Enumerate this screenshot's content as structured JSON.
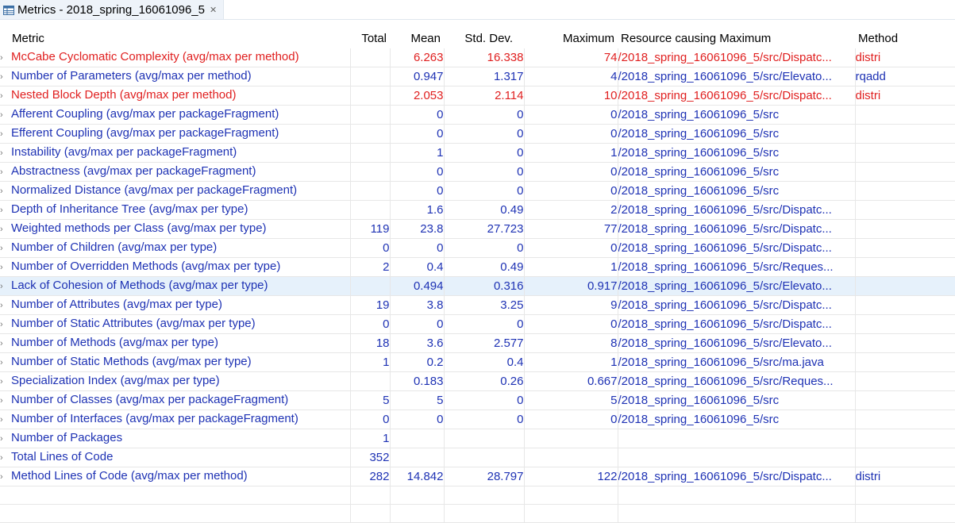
{
  "tab": {
    "title": "Metrics - 2018_spring_16061096_5",
    "close": "✕"
  },
  "columns": [
    "Metric",
    "Total",
    "Mean",
    "Std. Dev.",
    "Maximum",
    "Resource causing Maximum",
    "Method"
  ],
  "colors": {
    "normal": "#1e32b4",
    "warning": "#e02020",
    "selected_bg": "#e6f1fb"
  },
  "rows": [
    {
      "metric": "McCabe Cyclomatic Complexity (avg/max per method)",
      "total": "",
      "mean": "6.263",
      "std": "16.338",
      "max": "74",
      "resource": "/2018_spring_16061096_5/src/Dispatc...",
      "method": "distri",
      "status": "red"
    },
    {
      "metric": "Number of Parameters (avg/max per method)",
      "total": "",
      "mean": "0.947",
      "std": "1.317",
      "max": "4",
      "resource": "/2018_spring_16061096_5/src/Elevato...",
      "method": "rqadd",
      "status": "blue"
    },
    {
      "metric": "Nested Block Depth (avg/max per method)",
      "total": "",
      "mean": "2.053",
      "std": "2.114",
      "max": "10",
      "resource": "/2018_spring_16061096_5/src/Dispatc...",
      "method": "distri",
      "status": "red"
    },
    {
      "metric": "Afferent Coupling (avg/max per packageFragment)",
      "total": "",
      "mean": "0",
      "std": "0",
      "max": "0",
      "resource": "/2018_spring_16061096_5/src",
      "method": "",
      "status": "blue"
    },
    {
      "metric": "Efferent Coupling (avg/max per packageFragment)",
      "total": "",
      "mean": "0",
      "std": "0",
      "max": "0",
      "resource": "/2018_spring_16061096_5/src",
      "method": "",
      "status": "blue"
    },
    {
      "metric": "Instability (avg/max per packageFragment)",
      "total": "",
      "mean": "1",
      "std": "0",
      "max": "1",
      "resource": "/2018_spring_16061096_5/src",
      "method": "",
      "status": "blue"
    },
    {
      "metric": "Abstractness (avg/max per packageFragment)",
      "total": "",
      "mean": "0",
      "std": "0",
      "max": "0",
      "resource": "/2018_spring_16061096_5/src",
      "method": "",
      "status": "blue"
    },
    {
      "metric": "Normalized Distance (avg/max per packageFragment)",
      "total": "",
      "mean": "0",
      "std": "0",
      "max": "0",
      "resource": "/2018_spring_16061096_5/src",
      "method": "",
      "status": "blue"
    },
    {
      "metric": "Depth of Inheritance Tree (avg/max per type)",
      "total": "",
      "mean": "1.6",
      "std": "0.49",
      "max": "2",
      "resource": "/2018_spring_16061096_5/src/Dispatc...",
      "method": "",
      "status": "blue"
    },
    {
      "metric": "Weighted methods per Class (avg/max per type)",
      "total": "119",
      "mean": "23.8",
      "std": "27.723",
      "max": "77",
      "resource": "/2018_spring_16061096_5/src/Dispatc...",
      "method": "",
      "status": "blue"
    },
    {
      "metric": "Number of Children (avg/max per type)",
      "total": "0",
      "mean": "0",
      "std": "0",
      "max": "0",
      "resource": "/2018_spring_16061096_5/src/Dispatc...",
      "method": "",
      "status": "blue"
    },
    {
      "metric": "Number of Overridden Methods (avg/max per type)",
      "total": "2",
      "mean": "0.4",
      "std": "0.49",
      "max": "1",
      "resource": "/2018_spring_16061096_5/src/Reques...",
      "method": "",
      "status": "blue"
    },
    {
      "metric": "Lack of Cohesion of Methods (avg/max per type)",
      "total": "",
      "mean": "0.494",
      "std": "0.316",
      "max": "0.917",
      "resource": "/2018_spring_16061096_5/src/Elevato...",
      "method": "",
      "status": "blue",
      "selected": true
    },
    {
      "metric": "Number of Attributes (avg/max per type)",
      "total": "19",
      "mean": "3.8",
      "std": "3.25",
      "max": "9",
      "resource": "/2018_spring_16061096_5/src/Dispatc...",
      "method": "",
      "status": "blue"
    },
    {
      "metric": "Number of Static Attributes (avg/max per type)",
      "total": "0",
      "mean": "0",
      "std": "0",
      "max": "0",
      "resource": "/2018_spring_16061096_5/src/Dispatc...",
      "method": "",
      "status": "blue"
    },
    {
      "metric": "Number of Methods (avg/max per type)",
      "total": "18",
      "mean": "3.6",
      "std": "2.577",
      "max": "8",
      "resource": "/2018_spring_16061096_5/src/Elevato...",
      "method": "",
      "status": "blue"
    },
    {
      "metric": "Number of Static Methods (avg/max per type)",
      "total": "1",
      "mean": "0.2",
      "std": "0.4",
      "max": "1",
      "resource": "/2018_spring_16061096_5/src/ma.java",
      "method": "",
      "status": "blue"
    },
    {
      "metric": "Specialization Index (avg/max per type)",
      "total": "",
      "mean": "0.183",
      "std": "0.26",
      "max": "0.667",
      "resource": "/2018_spring_16061096_5/src/Reques...",
      "method": "",
      "status": "blue"
    },
    {
      "metric": "Number of Classes (avg/max per packageFragment)",
      "total": "5",
      "mean": "5",
      "std": "0",
      "max": "5",
      "resource": "/2018_spring_16061096_5/src",
      "method": "",
      "status": "blue"
    },
    {
      "metric": "Number of Interfaces (avg/max per packageFragment)",
      "total": "0",
      "mean": "0",
      "std": "0",
      "max": "0",
      "resource": "/2018_spring_16061096_5/src",
      "method": "",
      "status": "blue"
    },
    {
      "metric": "Number of Packages",
      "total": "1",
      "mean": "",
      "std": "",
      "max": "",
      "resource": "",
      "method": "",
      "status": "blue"
    },
    {
      "metric": "Total Lines of Code",
      "total": "352",
      "mean": "",
      "std": "",
      "max": "",
      "resource": "",
      "method": "",
      "status": "blue"
    },
    {
      "metric": "Method Lines of Code (avg/max per method)",
      "total": "282",
      "mean": "14.842",
      "std": "28.797",
      "max": "122",
      "resource": "/2018_spring_16061096_5/src/Dispatc...",
      "method": "distri",
      "status": "blue"
    }
  ]
}
